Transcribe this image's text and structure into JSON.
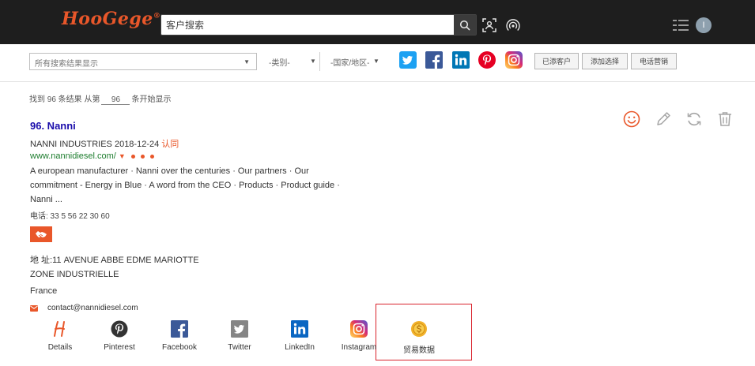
{
  "header": {
    "logo": "HooGege",
    "logo_mark": "®",
    "search_placeholder": "客户搜索",
    "avatar_initial": "I"
  },
  "filters": {
    "main_select": "所有搜索结果显示",
    "category_select": "-类别-",
    "country_select": "-国家/地区-",
    "buttons": [
      "已添客户",
      "添加选择",
      "电话营销"
    ]
  },
  "results": {
    "count_prefix": "找到 96 条结果  从第",
    "start_value": "96",
    "count_suffix": "条开始显示"
  },
  "listing": {
    "title": "96. Nanni",
    "company_date": "NANNI INDUSTRIES 2018-12-24",
    "claim_label": "认同",
    "url": "www.nannidiesel.com/",
    "description": "A european manufacturer · Nanni over the centuries · Our partners · Our commitment - Energy in Blue · A word from the CEO · Products · Product guide · Nanni ...",
    "phone": "电话: 33 5 56 22 30 60",
    "address_1": "地 址:11 AVENUE ABBE EDME MARIOTTE",
    "address_2": "ZONE INDUSTRIELLE",
    "address_3": "France",
    "email": "contact@nannidiesel.com"
  },
  "bottom_links": {
    "details": "Details",
    "pinterest": "Pinterest",
    "facebook": "Facebook",
    "twitter": "Twitter",
    "linkedin": "LinkedIn",
    "instagram": "Instagram",
    "trade": "贸易数据"
  },
  "colors": {
    "accent": "#e9572a",
    "header_bg": "#1e1e1e",
    "title_link": "#1a0dab",
    "url_green": "#1d7d2e",
    "highlight_border": "#d9232d"
  }
}
